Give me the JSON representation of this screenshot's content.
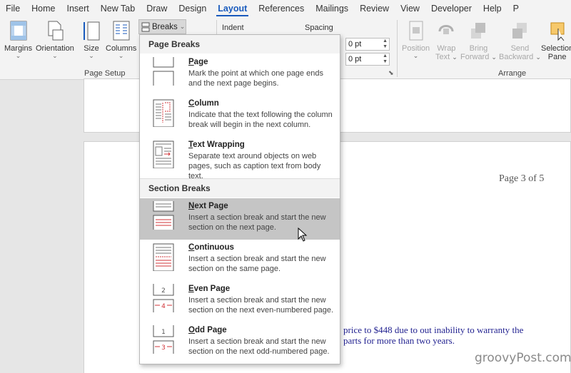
{
  "menu": {
    "tabs": [
      "File",
      "Home",
      "Insert",
      "New Tab",
      "Draw",
      "Design",
      "Layout",
      "References",
      "Mailings",
      "Review",
      "View",
      "Developer",
      "Help",
      "P"
    ],
    "active": "Layout"
  },
  "ribbon": {
    "margins": "Margins",
    "orientation": "Orientation",
    "size": "Size",
    "columns": "Columns",
    "breaks": "Breaks",
    "indent": "Indent",
    "spacing": "Spacing",
    "spacing_before": "0 pt",
    "spacing_after": "0 pt",
    "page_setup_label": "Page Setup",
    "position": "Position",
    "wrap": "Wrap",
    "wrap2": "Text",
    "bring": "Bring",
    "bring2": "Forward",
    "send": "Send",
    "send2": "Backward",
    "selection": "Selection",
    "selection2": "Pane",
    "arrange_label": "Arrange"
  },
  "document": {
    "page_number": "Page 3 of 5",
    "line1": "price to $448 due to out inability to warranty the",
    "line2": "parts for more than two years."
  },
  "dropdown": {
    "page_breaks_header": "Page Breaks",
    "section_breaks_header": "Section Breaks",
    "items": [
      {
        "title_u": "P",
        "title_rest": "age",
        "desc": "Mark the point at which one page ends and the next page begins."
      },
      {
        "title_u": "C",
        "title_rest": "olumn",
        "desc": "Indicate that the text following the column break will begin in the next column."
      },
      {
        "title_u": "T",
        "title_rest": "ext Wrapping",
        "desc": "Separate text around objects on web pages, such as caption text from body text."
      },
      {
        "title_u": "N",
        "title_rest": "ext Page",
        "desc": "Insert a section break and start the new section on the next page."
      },
      {
        "title_u": "C",
        "title_rest": "ontinuous",
        "desc": "Insert a section break and start the new section on the same page."
      },
      {
        "title_u": "E",
        "title_rest": "ven Page",
        "desc": "Insert a section break and start the new section on the next even-numbered page."
      },
      {
        "title_u": "O",
        "title_rest": "dd Page",
        "desc": "Insert a section break and start the new section on the next odd-numbered page."
      }
    ]
  },
  "watermark": "groovyPost.com",
  "colors": {
    "accent": "#185abd",
    "break_red": "#d13438",
    "hover": "#c5c5c5"
  }
}
